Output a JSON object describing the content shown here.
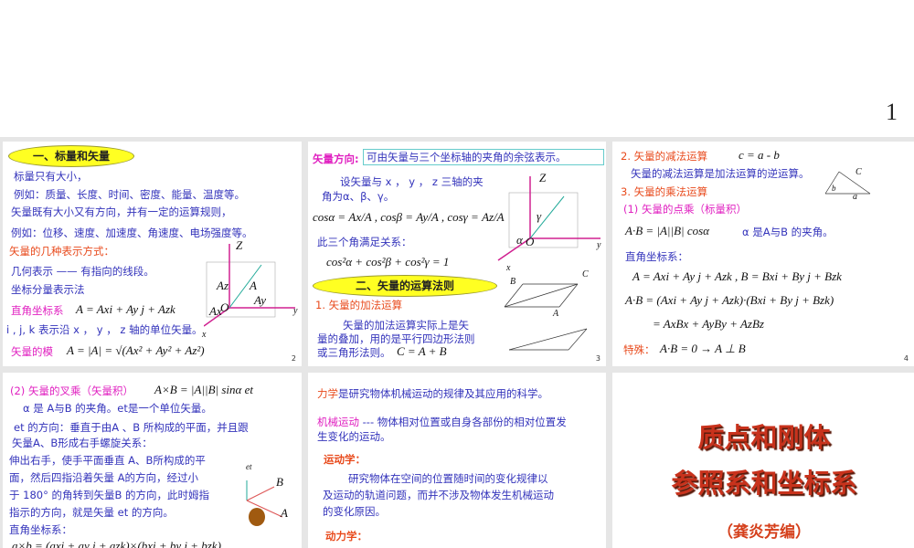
{
  "page_number": "1",
  "slide2": {
    "heading": "一、标量和矢量",
    "lines": [
      "标量只有大小，",
      "例如：质量、长度、时间、密度、能量、温度等。",
      "矢量既有大小又有方向，并有一定的运算规则，",
      "例如：位移、速度、加速度、角速度、电场强度等。",
      "矢量的几种表示方式：",
      "几何表示  —— 有指向的线段。",
      "坐标分量表示法",
      "直角坐标系",
      "A = Axi + Ay j + Azk",
      "i , j, k 表示沿 x ， y ， z 轴的单位矢量。",
      "矢量的模",
      "A = |A| = √(Ax² + Ay² + Az²)"
    ],
    "diagram_labels": [
      "Z",
      "A",
      "Az",
      "Ay",
      "Ax",
      "O",
      "y",
      "x"
    ],
    "slide_number": "2"
  },
  "slide3": {
    "direction_label": "矢量方向:",
    "direction_text": "可由矢量与三个坐标轴的夹角的余弦表示。",
    "lines": [
      "设矢量与 x ， y ， z 三轴的夹",
      "角为α、β、γ。",
      "cosα = Ax/A , cosβ = Ay/A , cosγ = Az/A",
      "此三个角满足关系：",
      "cos²α + cos²β + cos²γ = 1"
    ],
    "heading": "二、矢量的运算法则",
    "sub1": "1. 矢量的加法运算",
    "para": [
      "矢量的加法运算实际上是矢",
      "量的叠加，用的是平行四边形法则",
      "或三角形法则。"
    ],
    "formula": "C = A + B",
    "diagram_labels": [
      "Z",
      "γ",
      "α",
      "O",
      "y",
      "x",
      "B",
      "C",
      "A"
    ],
    "slide_number": "3"
  },
  "slide4": {
    "sub2": "2. 矢量的减法运算",
    "sub2_formula": "c = a - b",
    "sub2_text": "矢量的减法运算是加法运算的逆运算。",
    "sub3": "3. 矢量的乘法运算",
    "dot_title": "(1)  矢量的点乘（标量积）",
    "dot_formula": "A·B = |A||B| cosα",
    "dot_note": "α 是A与B 的夹角。",
    "cartesian": "直角坐标系：",
    "f1": "A = Axi + Ay j + Azk ,  B = Bxi + By j + Bzk",
    "f2": "A·B = (Axi + Ay j + Azk)·(Bxi + By j + Bzk)",
    "f3": "= AxBx + AyBy + AzBz",
    "special_label": "特殊：",
    "special": "A·B = 0 → A ⊥ B",
    "diagram_labels": [
      "C",
      "b",
      "a"
    ],
    "slide_number": "4"
  },
  "slide5": {
    "title": "(2)  矢量的叉乘（矢量积）",
    "formula": "A×B = |A||B| sinα et",
    "lines": [
      "α 是 A与B 的夹角。et是一个单位矢量。",
      "et 的方向：垂直于由A 、B 所构成的平面，并且跟",
      "矢量A、B形成右手螺旋关系：",
      "伸出右手，使手平面垂直 A、B所构成的平",
      "面，然后四指沿着矢量 A的方向，经过小",
      "于 180° 的角转到矢量B  的方向，此时姆指",
      "指示的方向，就是矢量   et 的方向。",
      "直角坐标系：",
      "a×b = (axi + ay j + azk)×(bxi + by j + bzk)"
    ],
    "diagram_labels": [
      "et",
      "B",
      "A"
    ]
  },
  "slide6": {
    "l1_key": "力学",
    "l1": "是研究物体机械运动的规律及其应用的科学。",
    "l2_key": "机械运动",
    "l2a": " --- 物体相对位置或自身各部份的相对位置发",
    "l2b": "生变化的运动。",
    "kin": "运动学：",
    "kin_text": [
      "研究物体在空间的位置随时间的变化规律以",
      "及运动的轨道问题，而并不涉及物体发生机械运动",
      "的变化原因。"
    ],
    "dyn": "动力学："
  },
  "slide7": {
    "title1": "质点和刚体",
    "title2": "参照系和坐标系",
    "author": "（龚炎芳编）"
  }
}
